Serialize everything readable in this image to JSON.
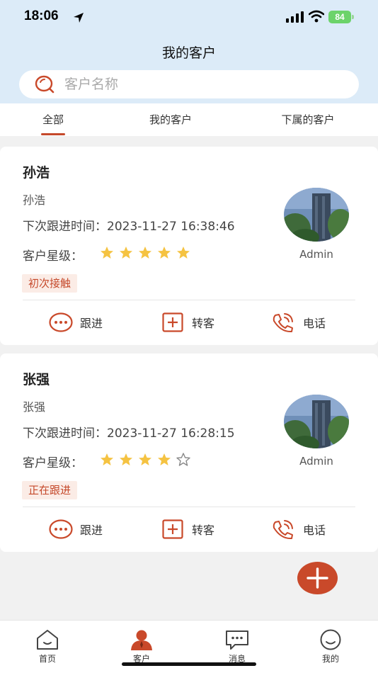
{
  "status_bar": {
    "time": "18:06",
    "battery": "84"
  },
  "header": {
    "title": "我的客户"
  },
  "search": {
    "placeholder": "客户名称"
  },
  "tabs": [
    {
      "label": "全部",
      "active": true
    },
    {
      "label": "我的客户",
      "active": false
    },
    {
      "label": "下属的客户",
      "active": false
    }
  ],
  "customers": [
    {
      "name": "孙浩",
      "contact": "孙浩",
      "follow_time": "下次跟进时间：2023-11-27 16:38:46",
      "star_label": "客户星级：",
      "stars": 5,
      "tag": "初次接触",
      "owner": "Admin"
    },
    {
      "name": "张强",
      "contact": "张强",
      "follow_time": "下次跟进时间：2023-11-27 16:28:15",
      "star_label": "客户星级：",
      "stars": 4,
      "tag": "正在跟进",
      "owner": "Admin"
    }
  ],
  "actions": {
    "follow": "跟进",
    "transfer": "转客",
    "call": "电话"
  },
  "nav": {
    "home": "首页",
    "customers": "客户",
    "messages": "消息",
    "me": "我的"
  },
  "colors": {
    "accent": "#c9492a",
    "header_bg": "#dcebf8",
    "star": "#f5c342"
  }
}
